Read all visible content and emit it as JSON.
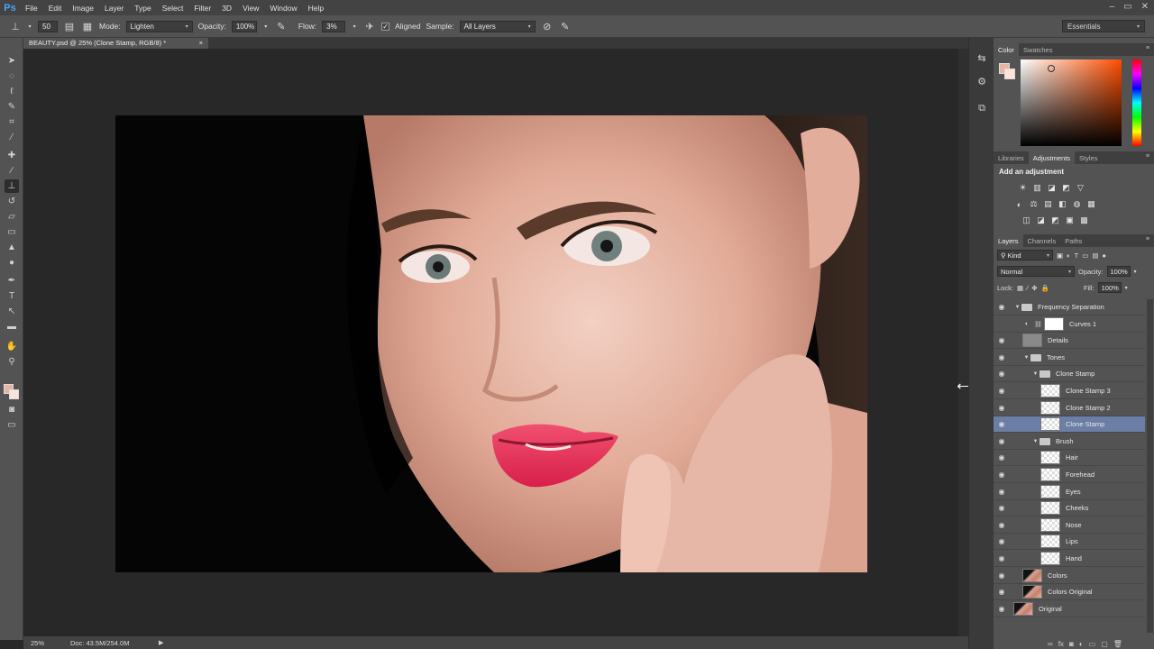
{
  "app": {
    "logo": "Ps",
    "menu": [
      "File",
      "Edit",
      "Image",
      "Layer",
      "Type",
      "Select",
      "Filter",
      "3D",
      "View",
      "Window",
      "Help"
    ],
    "window_controls": [
      "–",
      "▭",
      "✕"
    ]
  },
  "options_bar": {
    "brush_size": "50",
    "mode_label": "Mode:",
    "mode_value": "Lighten",
    "opacity_label": "Opacity:",
    "opacity_value": "100%",
    "flow_label": "Flow:",
    "flow_value": "3%",
    "aligned_label": "Aligned",
    "aligned_checked": true,
    "sample_label": "Sample:",
    "sample_value": "All Layers",
    "workspace": "Essentials"
  },
  "document": {
    "tab_title": "BEAUTY.psd @ 25% (Clone Stamp, RGB/8) *",
    "tab_close": "×",
    "active_tool": "clone-stamp-tool"
  },
  "status_bar": {
    "zoom": "25%",
    "doc_info": "Doc: 43.5M/254.0M",
    "arrow": "▶"
  },
  "color_panel": {
    "tabs": [
      "Color",
      "Swatches"
    ],
    "active_tab": "Color",
    "foreground": "#e8b4a4",
    "background": "#fbe3d8"
  },
  "adjustments_panel": {
    "tabs": [
      "Libraries",
      "Adjustments",
      "Styles"
    ],
    "active_tab": "Adjustments",
    "title": "Add an adjustment",
    "rows": [
      [
        "☀",
        "▥",
        "◪",
        "◩",
        "▽"
      ],
      [
        "◐",
        "⚖",
        "▤",
        "◧",
        "◍",
        "▦"
      ],
      [
        "◫",
        "◪",
        "◩",
        "▣",
        "▩"
      ]
    ]
  },
  "layers_panel": {
    "tabs": [
      "Layers",
      "Channels",
      "Paths"
    ],
    "active_tab": "Layers",
    "filter_label": "Kind",
    "blend_mode": "Normal",
    "opacity_label": "Opacity:",
    "opacity_value": "100%",
    "lock_label": "Lock:",
    "fill_label": "Fill:",
    "fill_value": "100%",
    "layers": [
      {
        "name": "Frequency Separation",
        "type": "group",
        "indent": 0,
        "expanded": true,
        "visible": true
      },
      {
        "name": "Curves 1",
        "type": "adjustment",
        "indent": 1,
        "visible": false
      },
      {
        "name": "Details",
        "type": "layer-gray",
        "indent": 1,
        "visible": true
      },
      {
        "name": "Tones",
        "type": "group",
        "indent": 1,
        "expanded": true,
        "visible": true
      },
      {
        "name": "Clone Stamp",
        "type": "group",
        "indent": 2,
        "expanded": true,
        "visible": true
      },
      {
        "name": "Clone Stamp 3",
        "type": "layer",
        "indent": 3,
        "visible": true
      },
      {
        "name": "Clone Stamp 2",
        "type": "layer",
        "indent": 3,
        "visible": true
      },
      {
        "name": "Clone Stamp",
        "type": "layer",
        "indent": 3,
        "visible": true,
        "selected": true
      },
      {
        "name": "Brush",
        "type": "group",
        "indent": 2,
        "expanded": true,
        "visible": true
      },
      {
        "name": "Hair",
        "type": "layer",
        "indent": 3,
        "visible": true
      },
      {
        "name": "Forehead",
        "type": "layer",
        "indent": 3,
        "visible": true
      },
      {
        "name": "Eyes",
        "type": "layer",
        "indent": 3,
        "visible": true
      },
      {
        "name": "Cheeks",
        "type": "layer",
        "indent": 3,
        "visible": true
      },
      {
        "name": "Nose",
        "type": "layer",
        "indent": 3,
        "visible": true
      },
      {
        "name": "Lips",
        "type": "layer",
        "indent": 3,
        "visible": true
      },
      {
        "name": "Hand",
        "type": "layer",
        "indent": 3,
        "visible": true
      },
      {
        "name": "Colors",
        "type": "layer-photo",
        "indent": 1,
        "visible": true
      },
      {
        "name": "Colors Original",
        "type": "layer-photo",
        "indent": 1,
        "visible": true
      },
      {
        "name": "Original",
        "type": "layer-photo",
        "indent": 0,
        "visible": true
      }
    ],
    "footer_icons": [
      "∞",
      "fx",
      "◙",
      "◐",
      "▭",
      "▢",
      "🗑"
    ]
  }
}
